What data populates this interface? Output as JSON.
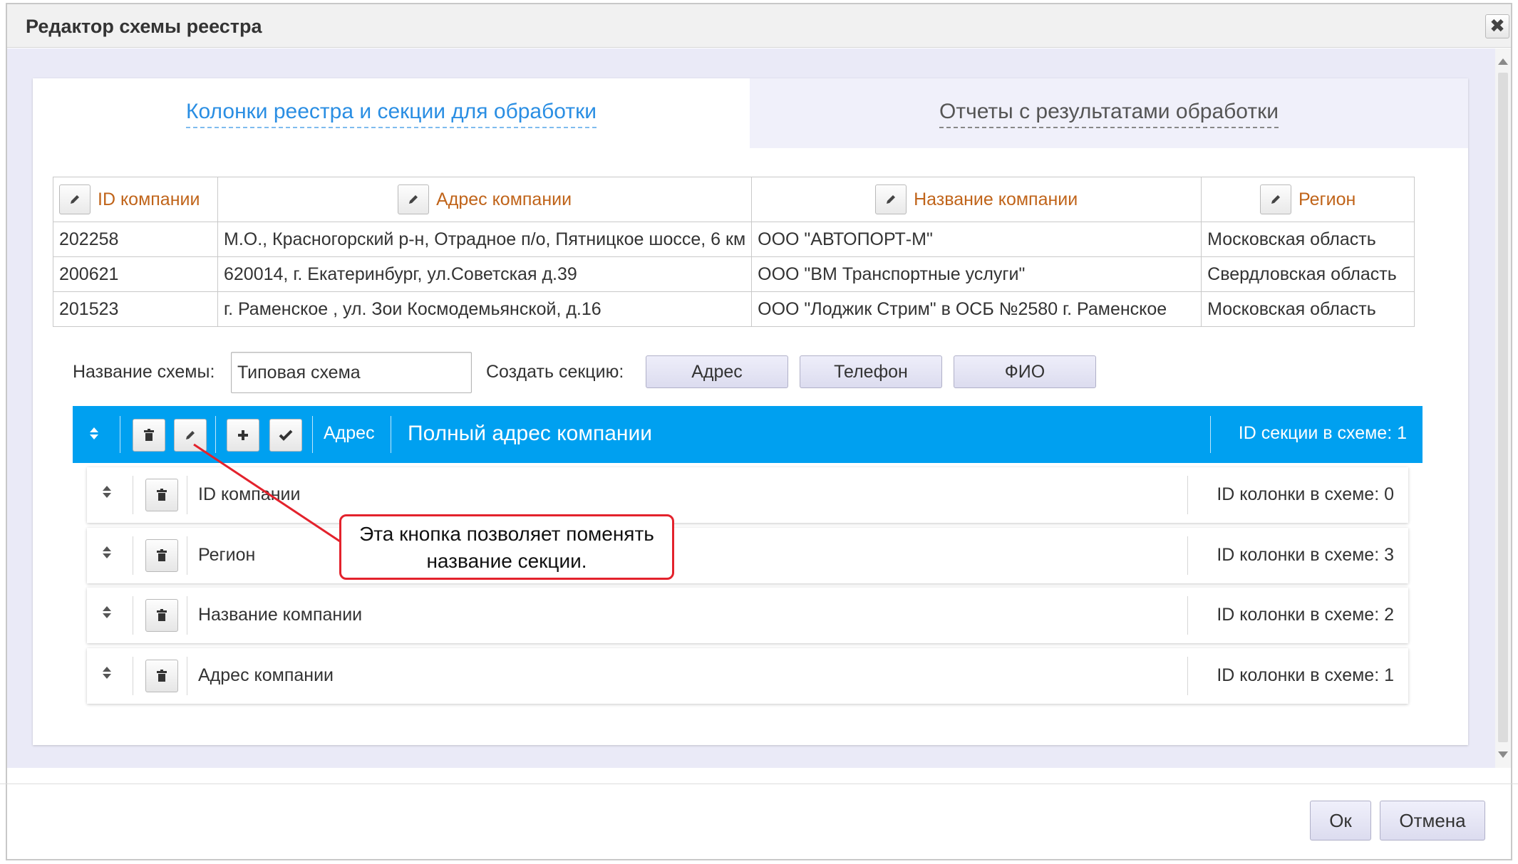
{
  "dialog": {
    "title": "Редактор схемы реестра",
    "close_glyph": "✖"
  },
  "tabs": [
    {
      "label": "Колонки реестра и секции для обработки",
      "active": true
    },
    {
      "label": "Отчеты с результатами обработки",
      "active": false
    }
  ],
  "table": {
    "headers": [
      "ID компании",
      "Адрес компании",
      "Название компании",
      "Регион"
    ],
    "rows": [
      [
        "202258",
        "М.О., Красногорский р-н, Отрадное п/о, Пятницкое шоссе, 6 км",
        "ООО \"АВТОПОРТ-М\"",
        "Московская область"
      ],
      [
        "200621",
        "620014, г. Екатеринбург, ул.Советская д.39",
        "ООО \"ВМ Транспортные услуги\"",
        "Свердловская область"
      ],
      [
        "201523",
        "г. Раменское , ул. Зои Космодемьянской, д.16",
        "ООО \"Лоджик Стрим\" в ОСБ №2580 г. Раменское",
        "Московская область"
      ]
    ]
  },
  "scheme": {
    "name_label": "Название схемы:",
    "name_value": "Типовая схема",
    "create_label": "Создать секцию:",
    "create_buttons": [
      "Адрес",
      "Телефон",
      "ФИО"
    ]
  },
  "section": {
    "type": "Адрес",
    "name": "Полный адрес компании",
    "id_label": "ID секции в схеме: 1"
  },
  "columns": [
    {
      "name": "ID компании",
      "id_label": "ID колонки в схеме: 0"
    },
    {
      "name": "Регион",
      "id_label": "ID колонки в схеме: 3"
    },
    {
      "name": "Название компании",
      "id_label": "ID колонки в схеме: 2"
    },
    {
      "name": "Адрес компании",
      "id_label": "ID колонки в схеме: 1"
    }
  ],
  "callout": {
    "line1": "Эта кнопка позволяет поменять",
    "line2": "название секции."
  },
  "footer": {
    "ok_label": "Ок",
    "cancel_label": "Отмена"
  },
  "colors": {
    "accent": "#00a0f0",
    "tab_active": "#2a8ee3",
    "header_text": "#c0641a",
    "callout_border": "#e3222c"
  },
  "icons": {
    "edit": "pencil-icon",
    "delete": "trash-icon",
    "add": "plus-icon",
    "confirm": "check-icon",
    "reorder": "updown-arrows-icon"
  }
}
